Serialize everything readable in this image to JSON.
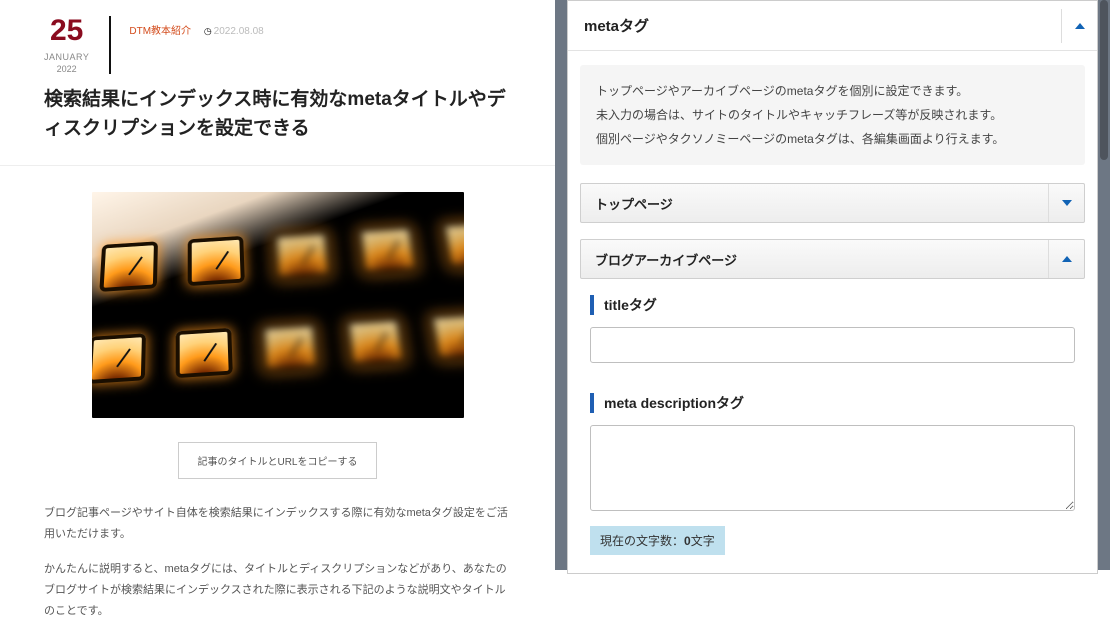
{
  "post": {
    "date_day": "25",
    "date_month": "JANUARY",
    "date_year": "2022",
    "category": "DTM教本紹介",
    "posted_on": "2022.08.08",
    "title": "検索結果にインデックス時に有効なmetaタイトルやディスクリプションを設定できる",
    "copy_button": "記事のタイトルとURLをコピーする",
    "paragraph1": "ブログ記事ページやサイト自体を検索結果にインデックスする際に有効なmetaタグ設定をご活用いただけます。",
    "paragraph2": "かんたんに説明すると、metaタグには、タイトルとディスクリプションなどがあり、あなたのブログサイトが検索結果にインデックスされた際に表示される下記のような説明文やタイトルのことです。"
  },
  "panel": {
    "title": "metaタグ",
    "desc_line1": "トップページやアーカイブページのmetaタグを個別に設定できます。",
    "desc_line2": "未入力の場合は、サイトのタイトルやキャッチフレーズ等が反映されます。",
    "desc_line3": "個別ページやタクソノミーページのmetaタグは、各編集画面より行えます。",
    "sections": {
      "top_page": {
        "label": "トップページ"
      },
      "blog_archive": {
        "label": "ブログアーカイブページ"
      }
    },
    "fields": {
      "title_tag_label": "titleタグ",
      "title_tag_value": "",
      "meta_desc_label": "meta descriptionタグ",
      "meta_desc_value": "",
      "char_count_prefix": "現在の文字数：",
      "char_count_value": "0",
      "char_count_suffix": "文字"
    }
  }
}
